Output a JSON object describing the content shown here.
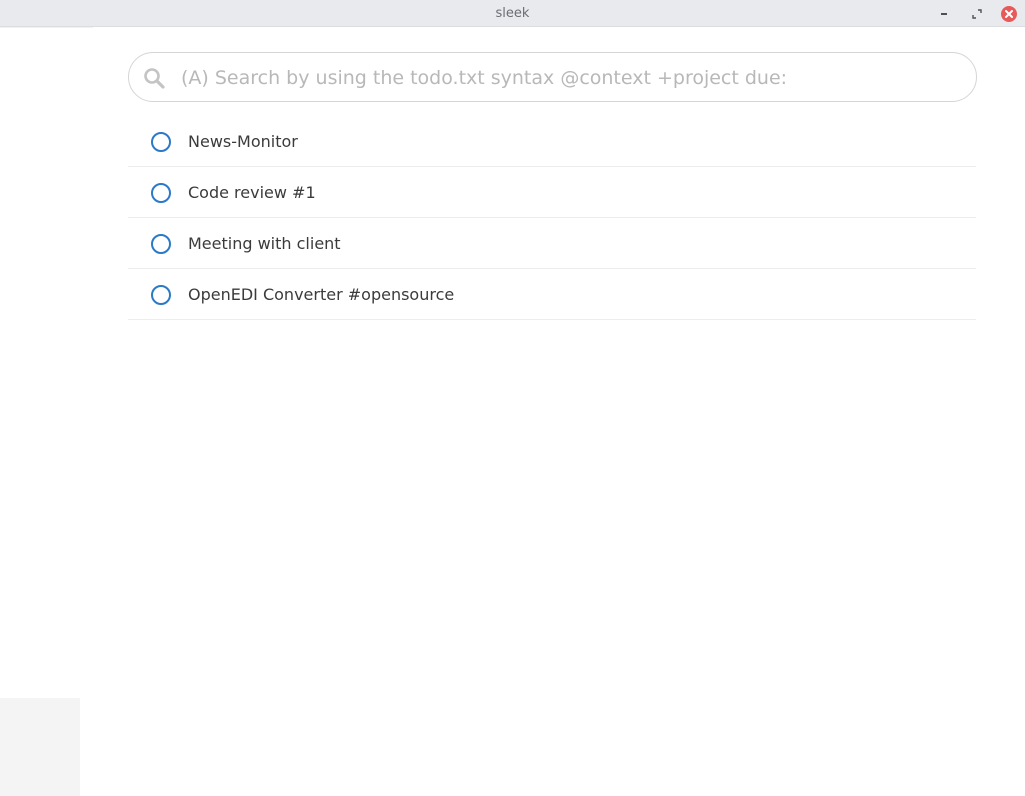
{
  "window": {
    "title": "sleek",
    "controls": {
      "minimize_icon": "minimize-icon",
      "maximize_icon": "maximize-icon",
      "close_icon": "close-icon",
      "close_color": "#e85a5a"
    }
  },
  "search": {
    "icon": "search-icon",
    "placeholder": "(A) Search by using the todo.txt syntax @context +project due:",
    "value": ""
  },
  "todos": [
    {
      "text": "News-Monitor",
      "completed": false
    },
    {
      "text": "Code review #1",
      "completed": false
    },
    {
      "text": "Meeting with client",
      "completed": false
    },
    {
      "text": "OpenEDI Converter #opensource",
      "completed": false
    }
  ],
  "colors": {
    "accent": "#2a7ac7",
    "text": "#3b3b3b",
    "placeholder": "#b8b8b8",
    "titlebar": "#e9eaee"
  }
}
